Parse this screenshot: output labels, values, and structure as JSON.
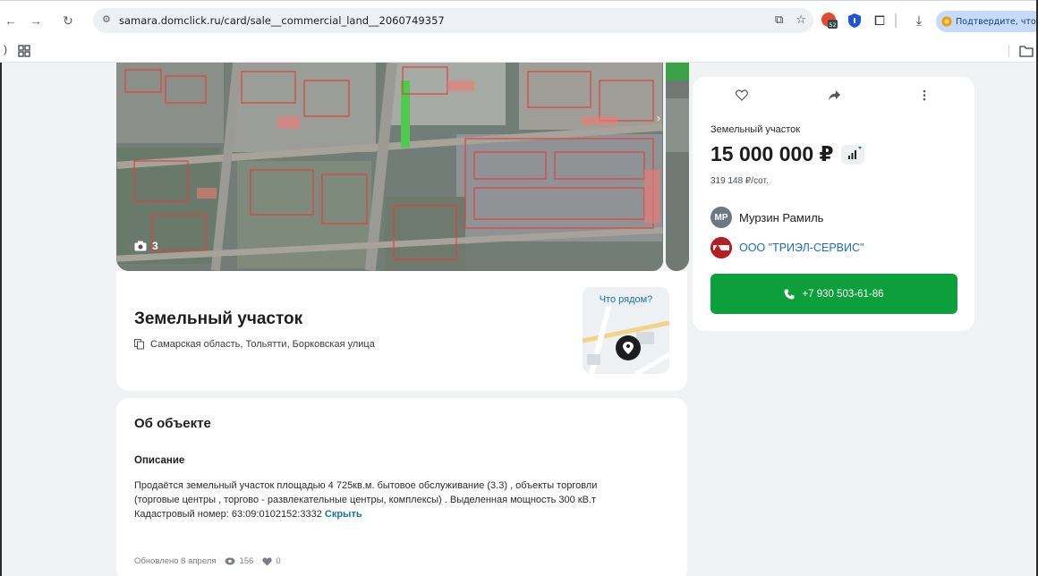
{
  "browser": {
    "url": "samara.domclick.ru/card/sale__commercial_land__2060749357",
    "extension_badge": "52",
    "confirm_text": "Подтвердите, что э",
    "left_edge_text": ")"
  },
  "gallery": {
    "photo_count": "3"
  },
  "listing": {
    "title": "Земельный участок",
    "address": "Самарская область, Тольятти, Борковская улица",
    "nearby_label": "Что рядом?"
  },
  "about": {
    "title": "Об объекте",
    "description_title": "Описание",
    "description_line1": "Продаётся земельный участок площадью 4 725кв.м. бытовое обслуживание (3.3) , объекты торговли",
    "description_line2": "(торговые центры , торгово - развлекательные центры, комплексы) . Выделенная мощность 300 кВ.т",
    "description_line3": "Кадастровый номер: 63:09:0102152:3332",
    "hide_link": "Скрыть",
    "updated": "Обновлено 8 апреля",
    "views": "156",
    "likes": "0"
  },
  "sidebar": {
    "property_type": "Земельный участок",
    "price": "15 000 000 ₽",
    "price_per_unit": "319 148 ₽/сот.",
    "agent_initials": "МР",
    "agent_name": "Мурзин Рамиль",
    "company_name": "ООО \"ТРИЭЛ-СЕРВИС\"",
    "phone": "+7 930 503-61-86"
  },
  "colors": {
    "accent_green": "#0c9f3b",
    "link_blue": "#1a6fb5",
    "page_bg": "#f1f2f4"
  }
}
